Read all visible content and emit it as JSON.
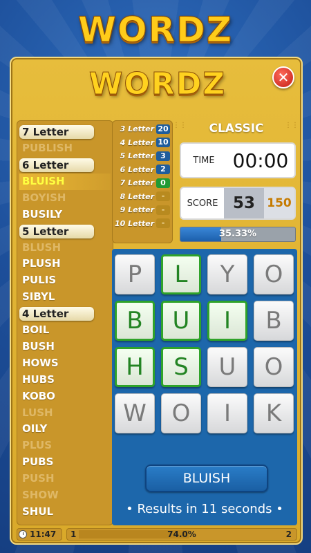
{
  "app": {
    "title": "WORDZ",
    "panel_title": "WORDZ",
    "close_symbol": "✕"
  },
  "word_list": [
    {
      "text": "7 Letter",
      "type": "header"
    },
    {
      "text": "PUBLISH",
      "type": "missing"
    },
    {
      "text": "6 Letter",
      "type": "header"
    },
    {
      "text": "BLUISH",
      "type": "highlight"
    },
    {
      "text": "BOYISH",
      "type": "missing"
    },
    {
      "text": "BUSILY",
      "type": "found"
    },
    {
      "text": "5 Letter",
      "type": "header"
    },
    {
      "text": "BLUSH",
      "type": "missing"
    },
    {
      "text": "PLUSH",
      "type": "found"
    },
    {
      "text": "PULIS",
      "type": "found"
    },
    {
      "text": "SIBYL",
      "type": "found"
    },
    {
      "text": "4 Letter",
      "type": "header"
    },
    {
      "text": "BOIL",
      "type": "found"
    },
    {
      "text": "BUSH",
      "type": "found"
    },
    {
      "text": "HOWS",
      "type": "found"
    },
    {
      "text": "HUBS",
      "type": "found"
    },
    {
      "text": "KOBO",
      "type": "found"
    },
    {
      "text": "LUSH",
      "type": "missing"
    },
    {
      "text": "OILY",
      "type": "found"
    },
    {
      "text": "PLUS",
      "type": "missing"
    },
    {
      "text": "PUBS",
      "type": "found"
    },
    {
      "text": "PUSH",
      "type": "missing"
    },
    {
      "text": "SHOW",
      "type": "missing"
    },
    {
      "text": "SHUL",
      "type": "found"
    }
  ],
  "letter_counts": [
    {
      "label": "3 Letter",
      "value": "20",
      "style": "blue"
    },
    {
      "label": "4 Letter",
      "value": "10",
      "style": "blue"
    },
    {
      "label": "5 Letter",
      "value": "3",
      "style": "blue"
    },
    {
      "label": "6 Letter",
      "value": "2",
      "style": "blue"
    },
    {
      "label": "7 Letter",
      "value": "0",
      "style": "green"
    },
    {
      "label": "8 Letter",
      "value": "-",
      "style": "empty"
    },
    {
      "label": "9 Letter",
      "value": "-",
      "style": "empty"
    },
    {
      "label": "10 Letter",
      "value": "-",
      "style": "empty"
    }
  ],
  "mode": "CLASSIC",
  "time": {
    "label": "TIME",
    "value": "00:00"
  },
  "score": {
    "label": "SCORE",
    "value": "53",
    "target": "150"
  },
  "progress": {
    "fraction": 0.3533,
    "label": "35.33%"
  },
  "board": {
    "tiles": [
      {
        "letter": "P",
        "selected": false
      },
      {
        "letter": "L",
        "selected": true
      },
      {
        "letter": "Y",
        "selected": false
      },
      {
        "letter": "O",
        "selected": false
      },
      {
        "letter": "B",
        "selected": true
      },
      {
        "letter": "U",
        "selected": true
      },
      {
        "letter": "I",
        "selected": true
      },
      {
        "letter": "B",
        "selected": false
      },
      {
        "letter": "H",
        "selected": true
      },
      {
        "letter": "S",
        "selected": true
      },
      {
        "letter": "U",
        "selected": false
      },
      {
        "letter": "O",
        "selected": false
      },
      {
        "letter": "W",
        "selected": false
      },
      {
        "letter": "O",
        "selected": false
      },
      {
        "letter": "I",
        "selected": false
      },
      {
        "letter": "K",
        "selected": false
      }
    ],
    "current_word": "BLUISH",
    "results_text": "• Results in 11 seconds •"
  },
  "footer": {
    "clock": "11:47",
    "level_start": "1",
    "level_end": "2",
    "level_fraction": 0.74,
    "level_label": "74.0%"
  },
  "colors": {
    "accent_gold": "#e7bd3c",
    "board_blue": "#1d67ab",
    "selected_green": "#2fa32a",
    "close_red": "#c21e16"
  }
}
